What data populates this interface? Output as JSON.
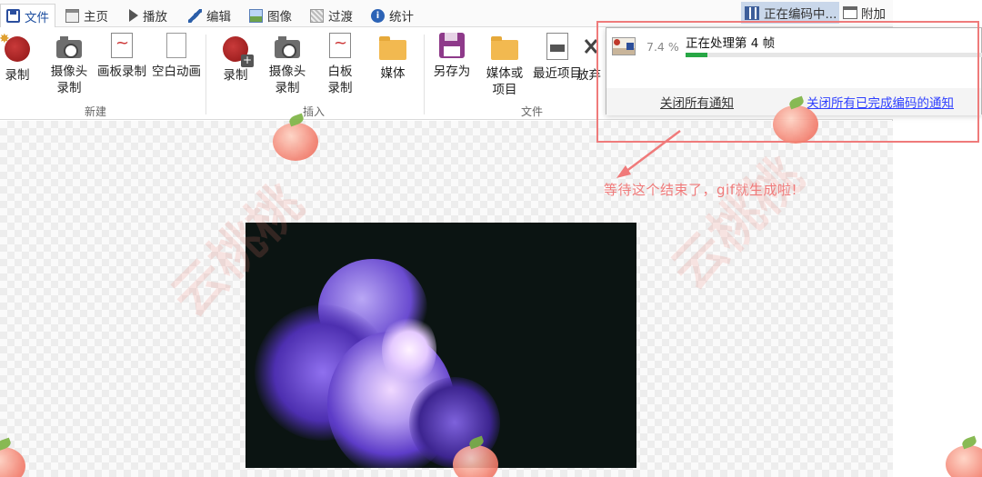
{
  "tabs": [
    {
      "label": "文件",
      "icon": "save-icon",
      "active": true
    },
    {
      "label": "主页",
      "icon": "home-icon"
    },
    {
      "label": "播放",
      "icon": "play-icon"
    },
    {
      "label": "编辑",
      "icon": "pencil-icon"
    },
    {
      "label": "图像",
      "icon": "image-icon"
    },
    {
      "label": "过渡",
      "icon": "transition-icon"
    },
    {
      "label": "统计",
      "icon": "info-icon"
    }
  ],
  "encoder_tab": {
    "label": "正在编码中..."
  },
  "addon_tab": {
    "label": "附加"
  },
  "ribbon": {
    "new_group": {
      "label": "新建",
      "buttons": [
        "录制",
        "摄像头\n录制",
        "画板录制",
        "空白动画"
      ]
    },
    "insert_group": {
      "label": "插入",
      "buttons": [
        "录制",
        "摄像头\n录制",
        "白板\n录制",
        "媒体"
      ]
    },
    "file_group": {
      "label": "文件",
      "buttons": [
        "另存为",
        "媒体或\n项目",
        "最近项目",
        "放弃"
      ]
    }
  },
  "notification": {
    "percent_text": "7.4 %",
    "progress": 0.074,
    "title": "正在处理第 4 帧",
    "close_all": "关闭所有通知",
    "close_completed": "关闭所有已完成编码的通知"
  },
  "annotation": {
    "note": "等待这个结束了，gif就生成啦!",
    "color": "#f07a7a"
  },
  "watermark": "云桃桃"
}
